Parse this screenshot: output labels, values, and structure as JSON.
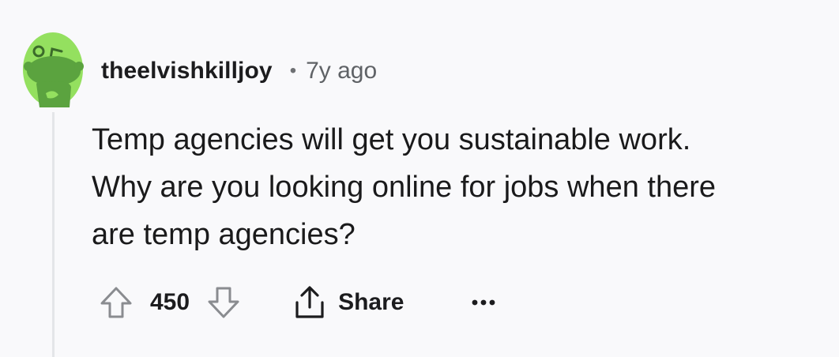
{
  "comment": {
    "username": "theelvishkilljoy",
    "separator": "•",
    "time_ago": "7y ago",
    "body_lines": [
      "Temp agencies will get you sustainable work.",
      "Why are you looking online for jobs when there",
      "are temp agencies?"
    ],
    "avatar_icon": "snoo-avatar-icon",
    "avatar_color": "#94e05f"
  },
  "actions": {
    "upvote_icon": "upvote-arrow-icon",
    "vote_count": "450",
    "downvote_icon": "downvote-arrow-icon",
    "share_icon": "share-upload-icon",
    "share_label": "Share",
    "more_icon": "more-options-icon"
  },
  "colors": {
    "background": "#f9f9fb",
    "text_primary": "#1c1c1e",
    "text_secondary": "#5f6266",
    "thread_line": "#e4e5e8"
  }
}
